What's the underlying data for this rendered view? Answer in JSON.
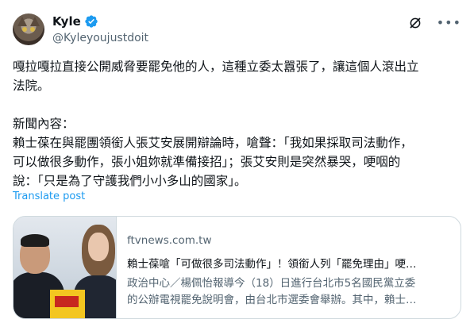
{
  "author": {
    "name": "Kyle",
    "handle": "@Kyleyoujustdoit",
    "verified_color": "#1d9bf0"
  },
  "icons": {
    "avatar": "cat-avatar",
    "verified": "verified-badge-icon",
    "grok": "grok-icon",
    "more": "more-icon"
  },
  "tweet": {
    "para1": [
      "嘎拉嘎拉直接公開威脅要罷免他的人，這種立委太囂張了，讓這個人滾出立",
      "法院。"
    ],
    "para2": [
      "新聞內容：",
      "賴士葆在與罷團領銜人張艾安展開辯論時，嗆聲：「我如果採取司法動作，",
      "可以做很多動作，張小姐妳就準備接招」；張艾安則是突然暴哭，哽咽的",
      "說：「只是為了守護我們小小多山的國家」。"
    ],
    "translate_label": "Translate post"
  },
  "card": {
    "domain": "ftvnews.com.tw",
    "title": "賴士葆嗆「可做很多司法動作」！領銜人列「罷免理由」哽…",
    "desc": [
      "政治中心／楊佩怡報導今（18）日進行台北市5名國民黨立委",
      "的公辦電視罷免說明會，由台北市選委會舉辦。其中，賴士…"
    ]
  },
  "colors": {
    "link": "#1d9bf0",
    "muted": "#536471",
    "text": "#0f1419",
    "border": "#cfd9de"
  }
}
